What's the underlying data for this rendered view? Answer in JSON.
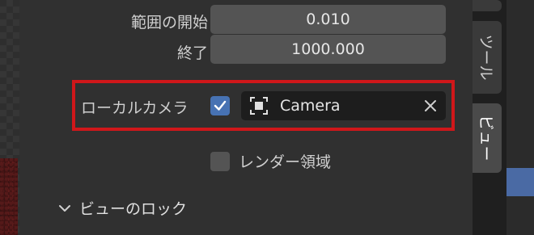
{
  "range": {
    "start_label": "範囲の開始",
    "start_value": "0.010",
    "end_label": "終了",
    "end_value": "1000.000"
  },
  "local_camera": {
    "label": "ローカルカメラ",
    "checked": true,
    "camera_name": "Camera"
  },
  "render_region": {
    "label": "レンダー領域",
    "checked": false
  },
  "view_lock": {
    "label": "ビューのロック",
    "expanded": false
  },
  "tabs": [
    {
      "label": "ツール",
      "active": false
    },
    {
      "label": "ビュー",
      "active": true
    }
  ],
  "colors": {
    "highlight": "#d0171a",
    "checkbox_checked": "#4772b3",
    "panel_bg": "#303030"
  },
  "icons": {
    "camera": "camera-frame-icon",
    "clear": "x-icon",
    "expand": "chevron-down-icon"
  }
}
